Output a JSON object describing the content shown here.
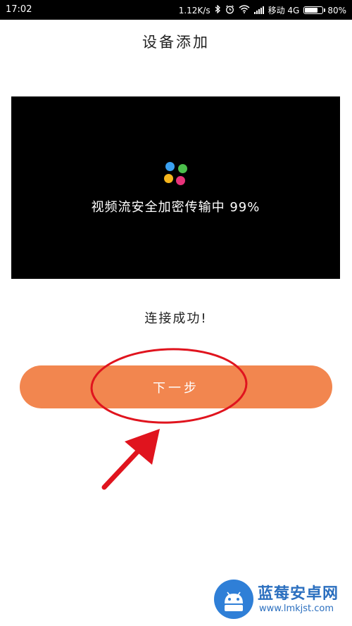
{
  "status_bar": {
    "time": "17:02",
    "network_speed": "1.12K/s",
    "carrier": "移动 4G",
    "battery_label": "80%",
    "battery_level": 0.8,
    "icons": [
      "bluetooth-icon",
      "alarm-icon",
      "wifi-icon",
      "hd-signal-icon",
      "battery-icon"
    ]
  },
  "page": {
    "title": "设备添加"
  },
  "video": {
    "loading_text": "视频流安全加密传输中 99%",
    "dot_colors": [
      "#3aa0f0",
      "#4cbf4c",
      "#f5b51c",
      "#e8337a"
    ]
  },
  "status_message": "连接成功!",
  "next_button": {
    "label": "下一步",
    "color": "#f2864f"
  },
  "annotation": {
    "color": "#e0141e"
  },
  "watermark": {
    "name": "蓝莓安卓网",
    "url": "www.lmkjst.com"
  }
}
